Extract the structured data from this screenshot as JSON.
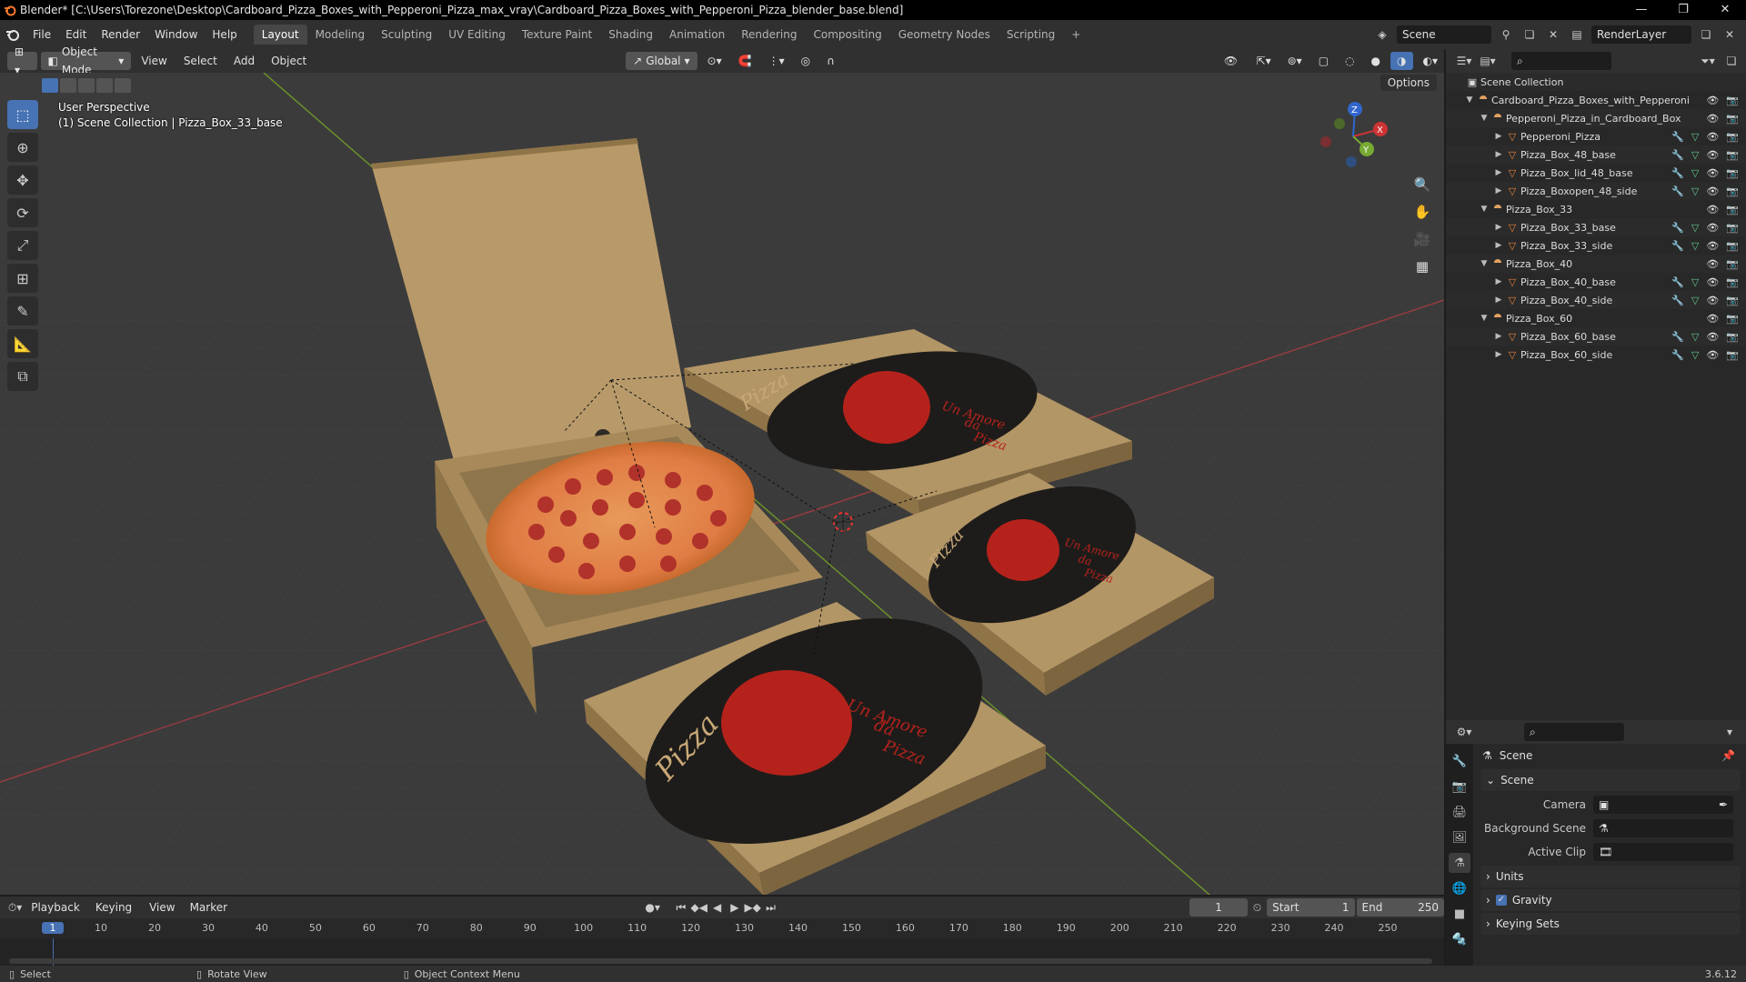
{
  "window": {
    "title": "Blender* [C:\\Users\\Torezone\\Desktop\\Cardboard_Pizza_Boxes_with_Pepperoni_Pizza_max_vray\\Cardboard_Pizza_Boxes_with_Pepperoni_Pizza_blender_base.blend]",
    "min": "—",
    "max": "❐",
    "close": "✕"
  },
  "menu": [
    "File",
    "Edit",
    "Render",
    "Window",
    "Help"
  ],
  "workspaces": [
    "Layout",
    "Modeling",
    "Sculpting",
    "UV Editing",
    "Texture Paint",
    "Shading",
    "Animation",
    "Rendering",
    "Compositing",
    "Geometry Nodes",
    "Scripting",
    "+"
  ],
  "scene_selector": {
    "scene": "Scene",
    "layer": "RenderLayer"
  },
  "viewport_header": {
    "mode": "Object Mode",
    "menus": [
      "View",
      "Select",
      "Add",
      "Object"
    ],
    "transform": "Global",
    "options": "Options"
  },
  "viewport": {
    "perspective": "User Perspective",
    "context": "(1) Scene Collection | Pizza_Box_33_base",
    "gizmo": {
      "x": "X",
      "y": "Y",
      "z": "Z"
    },
    "box_text": {
      "brand": "Pizza",
      "slogan1": "Un Amore",
      "slogan2": "da",
      "slogan3": "Pizza"
    }
  },
  "outliner": {
    "root": "Scene Collection",
    "rows": [
      {
        "name": "Cardboard_Pizza_Boxes_with_Pepperoni",
        "level": 1,
        "type": "collection"
      },
      {
        "name": "Pepperoni_Pizza_in_Cardboard_Box",
        "level": 2,
        "type": "collection"
      },
      {
        "name": "Pepperoni_Pizza",
        "level": 3,
        "type": "mesh"
      },
      {
        "name": "Pizza_Box_48_base",
        "level": 3,
        "type": "mesh"
      },
      {
        "name": "Pizza_Box_lid_48_base",
        "level": 3,
        "type": "mesh"
      },
      {
        "name": "Pizza_Boxopen_48_side",
        "level": 3,
        "type": "mesh"
      },
      {
        "name": "Pizza_Box_33",
        "level": 2,
        "type": "collection"
      },
      {
        "name": "Pizza_Box_33_base",
        "level": 3,
        "type": "mesh"
      },
      {
        "name": "Pizza_Box_33_side",
        "level": 3,
        "type": "mesh"
      },
      {
        "name": "Pizza_Box_40",
        "level": 2,
        "type": "collection"
      },
      {
        "name": "Pizza_Box_40_base",
        "level": 3,
        "type": "mesh"
      },
      {
        "name": "Pizza_Box_40_side",
        "level": 3,
        "type": "mesh"
      },
      {
        "name": "Pizza_Box_60",
        "level": 2,
        "type": "collection"
      },
      {
        "name": "Pizza_Box_60_base",
        "level": 3,
        "type": "mesh"
      },
      {
        "name": "Pizza_Box_60_side",
        "level": 3,
        "type": "mesh"
      }
    ]
  },
  "properties": {
    "context": "Scene",
    "panel": "Scene",
    "camera_label": "Camera",
    "bg_label": "Background Scene",
    "clip_label": "Active Clip",
    "units": "Units",
    "gravity": "Gravity",
    "keying": "Keying Sets"
  },
  "timeline": {
    "menus": [
      "Playback",
      "Keying",
      "View",
      "Marker"
    ],
    "current_frame": "1",
    "start_label": "Start",
    "start": "1",
    "end_label": "End",
    "end": "250",
    "ticks": [
      "1",
      "10",
      "20",
      "30",
      "40",
      "50",
      "60",
      "70",
      "80",
      "90",
      "100",
      "110",
      "120",
      "130",
      "140",
      "150",
      "160",
      "170",
      "180",
      "190",
      "200",
      "210",
      "220",
      "230",
      "240",
      "250"
    ]
  },
  "status": {
    "select": "Select",
    "rotate": "Rotate View",
    "context_menu": "Object Context Menu",
    "version": "3.6.12"
  },
  "colors": {
    "accent": "#4772b3",
    "blender_orange": "#f5792a",
    "cardboard": "#b39666",
    "box_print": "#1e1c1a",
    "heart_red": "#b5221c"
  }
}
